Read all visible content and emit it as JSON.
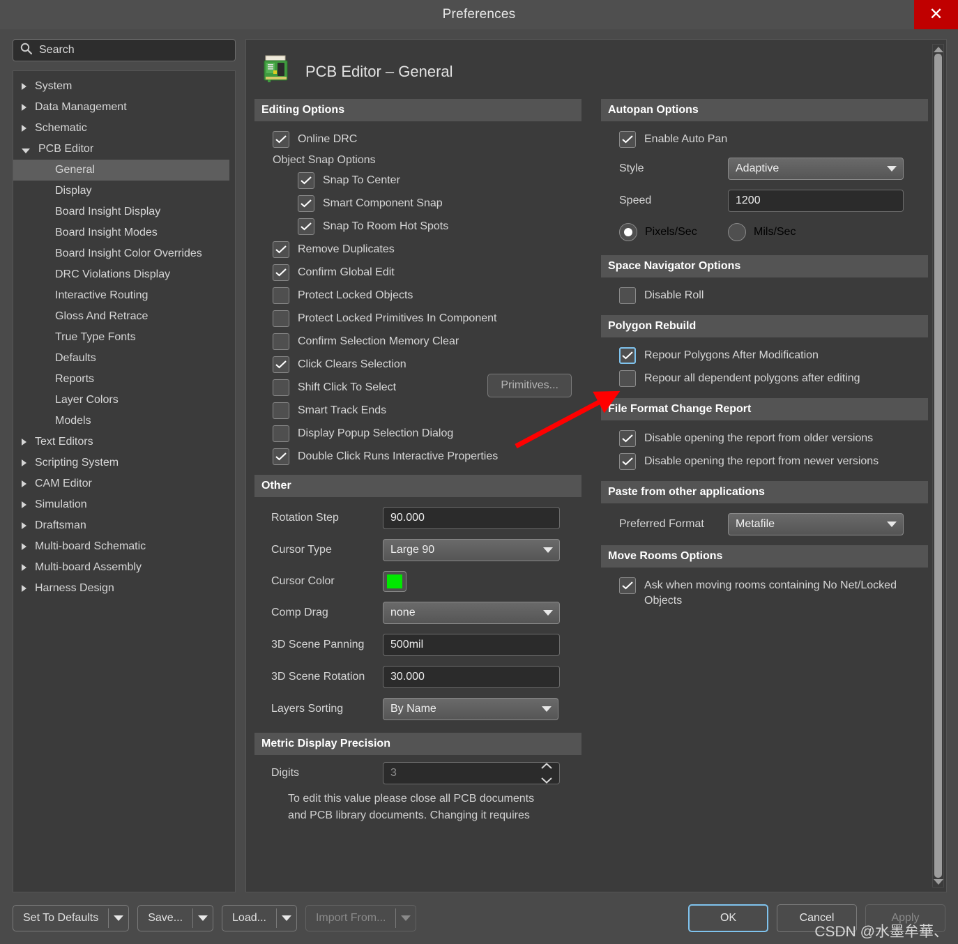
{
  "window": {
    "title": "Preferences",
    "close_label": "✕"
  },
  "search": {
    "placeholder": "Search",
    "icon": "search-icon"
  },
  "sidebar": {
    "items": [
      {
        "label": "System",
        "level": 0,
        "state": "collapsed"
      },
      {
        "label": "Data Management",
        "level": 0,
        "state": "collapsed"
      },
      {
        "label": "Schematic",
        "level": 0,
        "state": "collapsed"
      },
      {
        "label": "PCB Editor",
        "level": 0,
        "state": "expanded"
      },
      {
        "label": "General",
        "level": 1,
        "state": "selected"
      },
      {
        "label": "Display",
        "level": 1,
        "state": "leaf"
      },
      {
        "label": "Board Insight Display",
        "level": 1,
        "state": "leaf"
      },
      {
        "label": "Board Insight Modes",
        "level": 1,
        "state": "leaf"
      },
      {
        "label": "Board Insight Color Overrides",
        "level": 1,
        "state": "leaf"
      },
      {
        "label": "DRC Violations Display",
        "level": 1,
        "state": "leaf"
      },
      {
        "label": "Interactive Routing",
        "level": 1,
        "state": "leaf"
      },
      {
        "label": "Gloss And Retrace",
        "level": 1,
        "state": "leaf"
      },
      {
        "label": "True Type Fonts",
        "level": 1,
        "state": "leaf"
      },
      {
        "label": "Defaults",
        "level": 1,
        "state": "leaf"
      },
      {
        "label": "Reports",
        "level": 1,
        "state": "leaf"
      },
      {
        "label": "Layer Colors",
        "level": 1,
        "state": "leaf"
      },
      {
        "label": "Models",
        "level": 1,
        "state": "leaf"
      },
      {
        "label": "Text Editors",
        "level": 0,
        "state": "collapsed"
      },
      {
        "label": "Scripting System",
        "level": 0,
        "state": "collapsed"
      },
      {
        "label": "CAM Editor",
        "level": 0,
        "state": "collapsed"
      },
      {
        "label": "Simulation",
        "level": 0,
        "state": "collapsed"
      },
      {
        "label": "Draftsman",
        "level": 0,
        "state": "collapsed"
      },
      {
        "label": "Multi-board Schematic",
        "level": 0,
        "state": "collapsed"
      },
      {
        "label": "Multi-board Assembly",
        "level": 0,
        "state": "collapsed"
      },
      {
        "label": "Harness Design",
        "level": 0,
        "state": "collapsed"
      }
    ]
  },
  "page": {
    "title": "PCB Editor – General",
    "icon": "pcb-board-icon"
  },
  "editing_options": {
    "heading": "Editing Options",
    "online_drc": {
      "label": "Online DRC",
      "checked": true
    },
    "object_snap_label": "Object Snap Options",
    "snap_to_center": {
      "label": "Snap To Center",
      "checked": true
    },
    "smart_component_snap": {
      "label": "Smart Component Snap",
      "checked": true
    },
    "snap_to_room_hot_spots": {
      "label": "Snap To Room Hot Spots",
      "checked": true
    },
    "remove_duplicates": {
      "label": "Remove Duplicates",
      "checked": true
    },
    "confirm_global_edit": {
      "label": "Confirm Global Edit",
      "checked": true
    },
    "protect_locked_objects": {
      "label": "Protect Locked Objects",
      "checked": false
    },
    "protect_locked_primitives": {
      "label": "Protect Locked Primitives In Component",
      "checked": false
    },
    "confirm_selection_memory_clear": {
      "label": "Confirm Selection Memory Clear",
      "checked": false
    },
    "click_clears_selection": {
      "label": "Click Clears Selection",
      "checked": true
    },
    "shift_click_to_select": {
      "label": "Shift Click To Select",
      "checked": false
    },
    "smart_track_ends": {
      "label": "Smart Track Ends",
      "checked": false
    },
    "display_popup_selection_dialog": {
      "label": "Display Popup Selection Dialog",
      "checked": false
    },
    "double_click_runs": {
      "label": "Double Click Runs Interactive Properties",
      "checked": true
    },
    "primitives_button": {
      "label": "Primitives...",
      "disabled": true
    }
  },
  "other": {
    "heading": "Other",
    "rotation_step": {
      "label": "Rotation Step",
      "value": "90.000"
    },
    "cursor_type": {
      "label": "Cursor Type",
      "value": "Large 90"
    },
    "cursor_color": {
      "label": "Cursor Color",
      "value": "#00E800"
    },
    "comp_drag": {
      "label": "Comp Drag",
      "value": "none"
    },
    "scene_panning": {
      "label": "3D Scene Panning",
      "value": "500mil"
    },
    "scene_rotation": {
      "label": "3D Scene Rotation",
      "value": "30.000"
    },
    "layers_sorting": {
      "label": "Layers Sorting",
      "value": "By Name"
    }
  },
  "metric_display_precision": {
    "heading": "Metric Display Precision",
    "digits": {
      "label": "Digits",
      "value": "3",
      "disabled": true
    },
    "note": "To edit this value please close all PCB documents and PCB library documents. Changing it requires"
  },
  "autopan": {
    "heading": "Autopan Options",
    "enable": {
      "label": "Enable Auto Pan",
      "checked": true
    },
    "style": {
      "label": "Style",
      "value": "Adaptive"
    },
    "speed": {
      "label": "Speed",
      "value": "1200"
    },
    "unit_pixels": {
      "label": "Pixels/Sec",
      "selected": true
    },
    "unit_mils": {
      "label": "Mils/Sec",
      "selected": false
    }
  },
  "space_navigator": {
    "heading": "Space Navigator Options",
    "disable_roll": {
      "label": "Disable Roll",
      "checked": false
    }
  },
  "polygon_rebuild": {
    "heading": "Polygon Rebuild",
    "repour_after_modification": {
      "label": "Repour Polygons After Modification",
      "checked": true,
      "focused": true
    },
    "repour_dependent": {
      "label": "Repour all dependent polygons after editing",
      "checked": false
    }
  },
  "file_format_change_report": {
    "heading": "File Format Change Report",
    "disable_older": {
      "label": "Disable opening the report from older versions",
      "checked": true
    },
    "disable_newer": {
      "label": "Disable opening the report from newer versions",
      "checked": true
    }
  },
  "paste_from_other_apps": {
    "heading": "Paste from other applications",
    "preferred_format": {
      "label": "Preferred Format",
      "value": "Metafile"
    }
  },
  "move_rooms": {
    "heading": "Move Rooms Options",
    "ask_when_moving": {
      "label": "Ask when moving rooms containing No Net/Locked Objects",
      "checked": true
    }
  },
  "footer": {
    "set_to_defaults": "Set To Defaults",
    "save": "Save...",
    "load": "Load...",
    "import_from": "Import From...",
    "ok": "OK",
    "cancel": "Cancel",
    "apply": "Apply"
  },
  "watermark": "CSDN @水墨牟華、",
  "colors": {
    "accent_focus": "#7fc3ee",
    "close_red": "#c00000",
    "annotation_arrow": "#ff0000",
    "cursor_green": "#00E800"
  }
}
